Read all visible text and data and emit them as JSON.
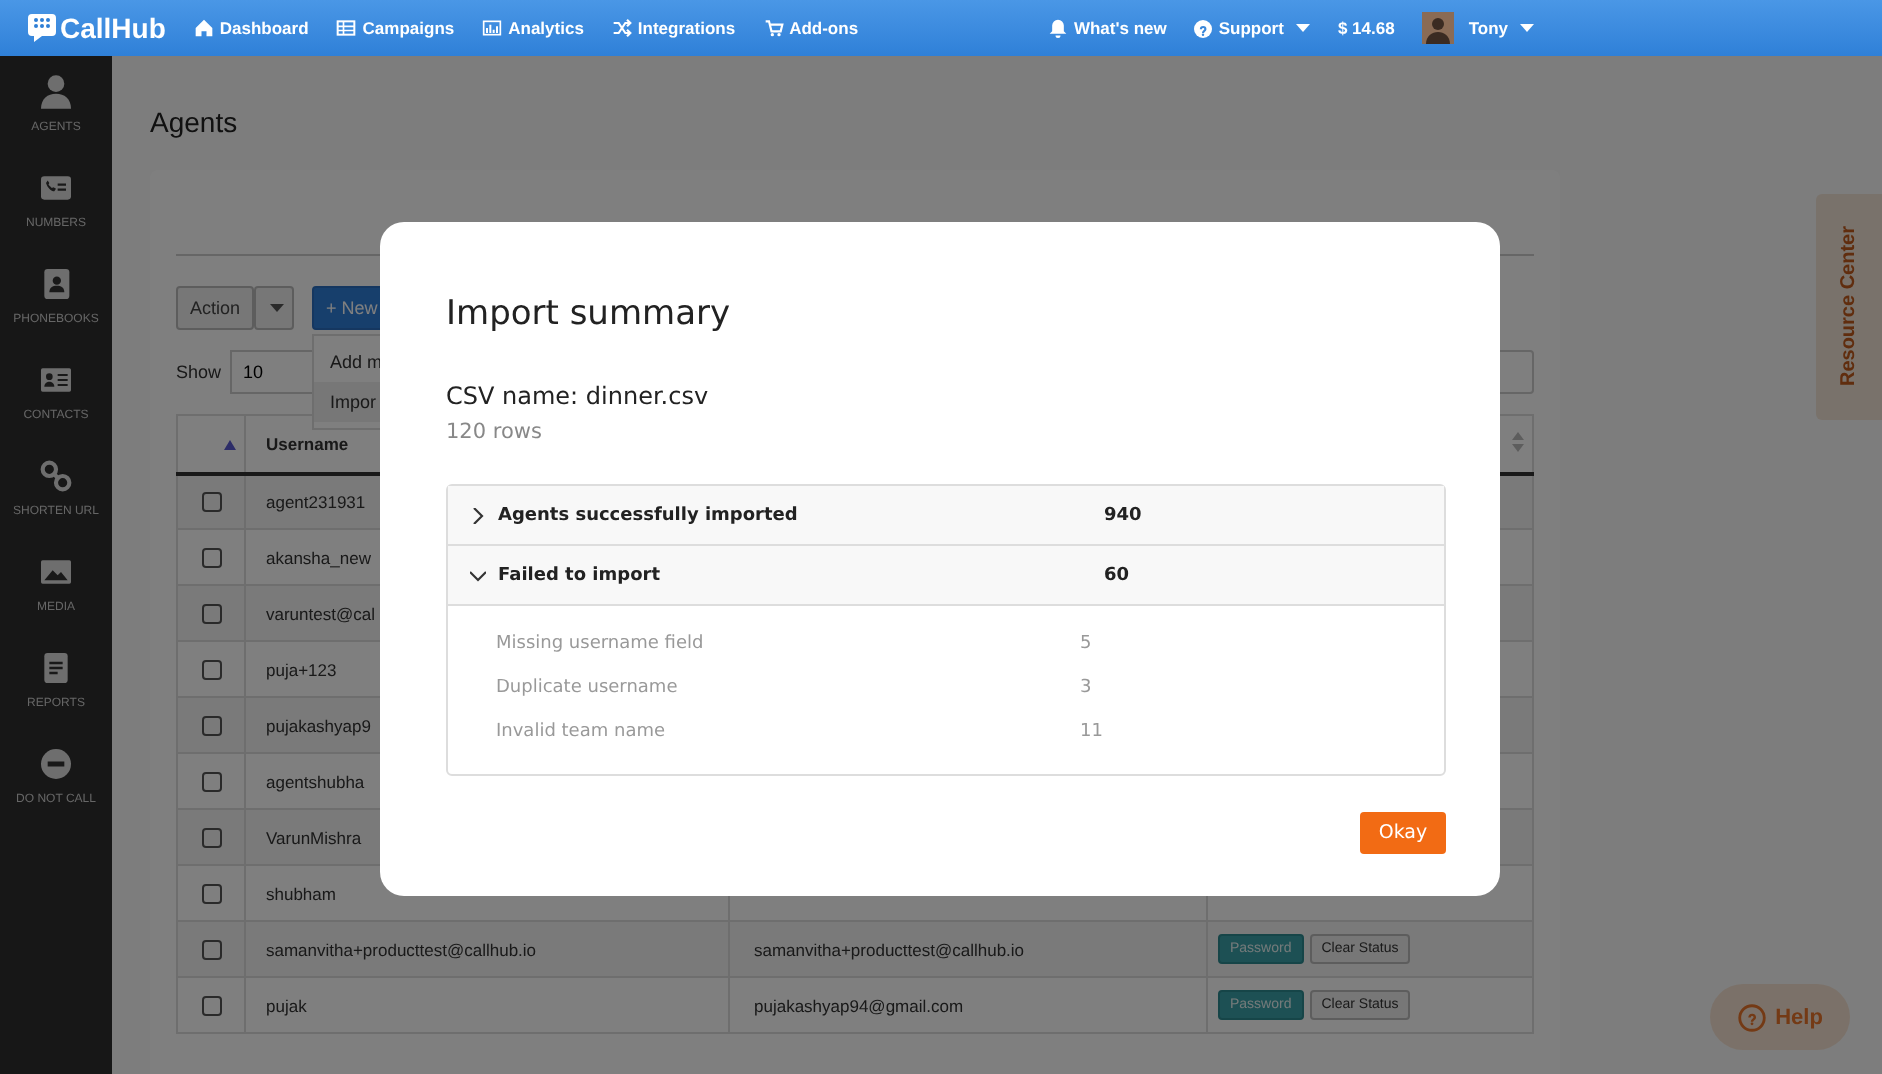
{
  "topnav": {
    "logo": "CallHub",
    "items": [
      {
        "label": "Dashboard"
      },
      {
        "label": "Campaigns"
      },
      {
        "label": "Analytics"
      },
      {
        "label": "Integrations"
      },
      {
        "label": "Add-ons"
      }
    ],
    "whats_new": "What's new",
    "support": "Support",
    "balance": "$ 14.68",
    "user": "Tony"
  },
  "sidebar": {
    "items": [
      {
        "label": "AGENTS"
      },
      {
        "label": "NUMBERS"
      },
      {
        "label": "PHONEBOOKS"
      },
      {
        "label": "CONTACTS"
      },
      {
        "label": "SHORTEN URL"
      },
      {
        "label": "MEDIA"
      },
      {
        "label": "REPORTS"
      },
      {
        "label": "DO NOT CALL"
      }
    ]
  },
  "page": {
    "title": "Agents",
    "action_button": "Action",
    "new_button": "+ New",
    "new_menu": [
      "Add m",
      "Impor"
    ],
    "show_label": "Show",
    "show_value": "10"
  },
  "table": {
    "columns": [
      "Username"
    ],
    "rows": [
      {
        "checked": false,
        "username": "agent231931"
      },
      {
        "checked": false,
        "username": "akansha_new"
      },
      {
        "checked": false,
        "username": "varuntest@cal"
      },
      {
        "checked": false,
        "username": "puja+123"
      },
      {
        "checked": false,
        "username": "pujakashyap9"
      },
      {
        "checked": false,
        "username": "agentshubha"
      },
      {
        "checked": false,
        "username": "VarunMishra"
      },
      {
        "checked": false,
        "username": "shubham"
      },
      {
        "checked": false,
        "username": "samanvitha+producttest@callhub.io",
        "email": "samanvitha+producttest@callhub.io",
        "buttons": [
          "Password",
          "Clear Status"
        ]
      },
      {
        "checked": false,
        "username": "pujak",
        "email": "pujakashyap94@gmail.com",
        "buttons": [
          "Password",
          "Clear Status"
        ]
      }
    ]
  },
  "resource_center": "Resource Center",
  "help": "Help",
  "modal": {
    "title": "Import summary",
    "csv_name": "CSV name: dinner.csv",
    "rows": "120 rows",
    "sections": [
      {
        "label": "Agents successfully imported",
        "count": "940",
        "expanded": false
      },
      {
        "label": "Failed to import",
        "count": "60",
        "expanded": true,
        "children": [
          {
            "label": "Missing username field",
            "count": "5"
          },
          {
            "label": "Duplicate username",
            "count": "3"
          },
          {
            "label": "Invalid team name",
            "count": "11"
          }
        ]
      }
    ],
    "ok_button": "Okay"
  }
}
